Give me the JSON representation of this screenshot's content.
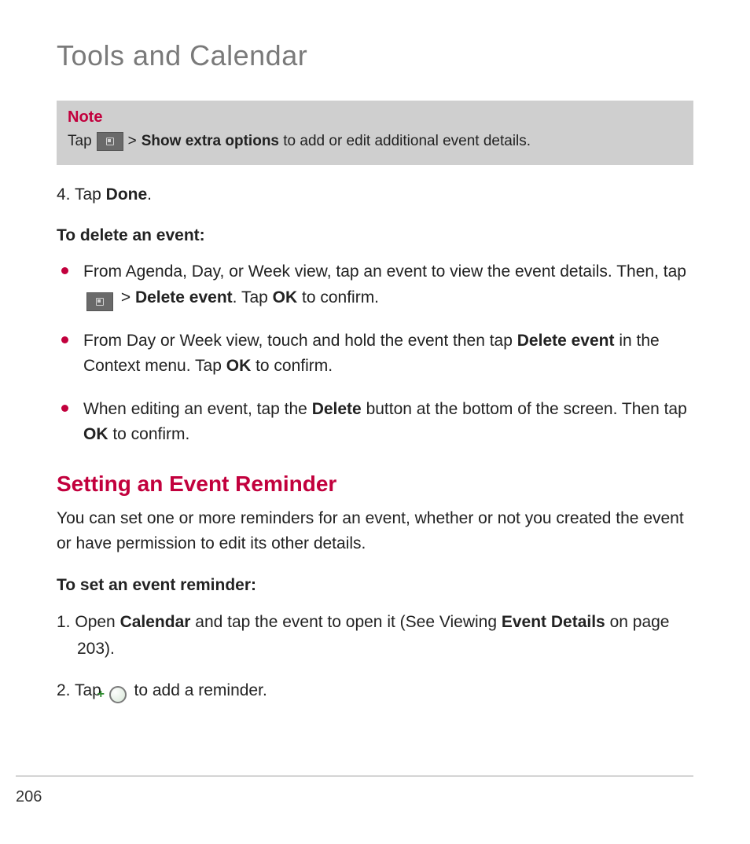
{
  "header": {
    "title": "Tools and Calendar"
  },
  "note": {
    "label": "Note",
    "tap": "Tap",
    "gt": ">",
    "show_extra": "Show extra options",
    "rest": " to add or edit additional event details."
  },
  "step4": {
    "prefix": "4. Tap ",
    "done": "Done",
    "suffix": "."
  },
  "delete_heading": "To delete an event:",
  "bullets": [
    {
      "pre": "From Agenda, Day, or Week view, tap an event to view the event details. Then, tap ",
      "gt": " > ",
      "b1": "Delete event",
      "mid": ". Tap ",
      "b2": "OK",
      "post": " to confirm."
    },
    {
      "pre": "From Day or Week view, touch and hold the event then tap ",
      "b1": "Delete event",
      "mid": " in the Context menu. Tap ",
      "b2": "OK",
      "post": " to confirm."
    },
    {
      "pre": "When editing an event, tap the ",
      "b1": "Delete",
      "mid": " button at the bottom of the screen. Then tap ",
      "b2": "OK",
      "post": " to confirm."
    }
  ],
  "section": {
    "title": "Setting an Event Reminder",
    "intro": "You can set one or more reminders for an event, whether or not you created the event or have permission to edit its other details."
  },
  "set_heading": "To set an event reminder:",
  "steps": [
    {
      "num": "1. ",
      "pre": "Open ",
      "b1": "Calendar",
      "mid": " and tap the event to open it (See Viewing ",
      "b2": "Event Details",
      "post": " on page 203)."
    },
    {
      "num": "2. ",
      "pre": "Tap ",
      "post": " to add a reminder."
    }
  ],
  "plus_glyph": "+",
  "page_number": "206"
}
